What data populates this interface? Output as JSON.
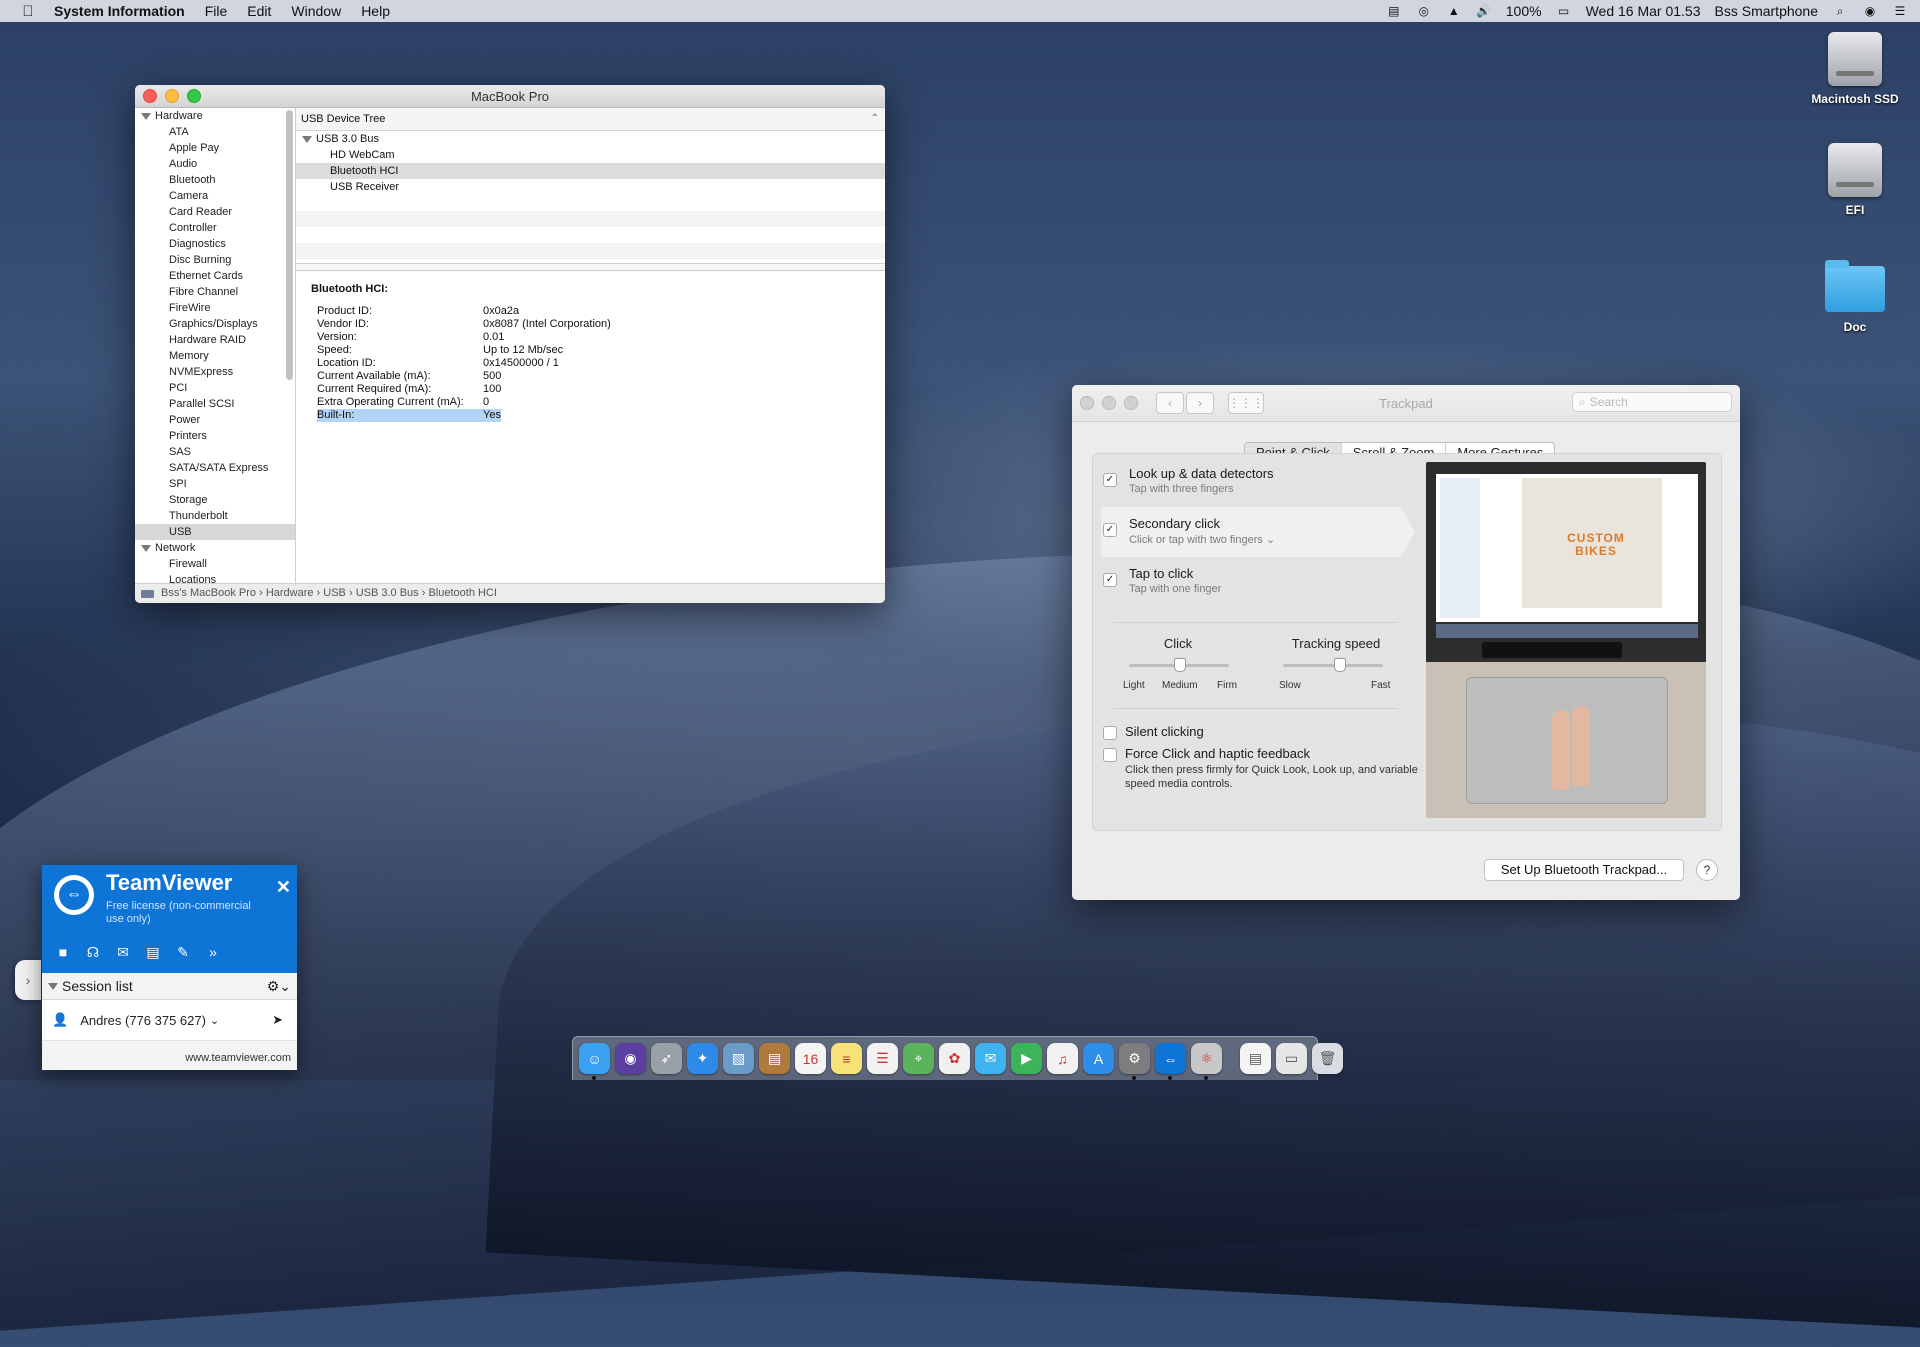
{
  "menubar": {
    "app": "System Information",
    "menus": [
      "File",
      "Edit",
      "Window",
      "Help"
    ],
    "battery": "100%",
    "datetime": "Wed 16 Mar  01.53",
    "user": "Bss Smartphone"
  },
  "desktop": {
    "icons": [
      {
        "label": "Macintosh SSD",
        "kind": "drive"
      },
      {
        "label": "EFI",
        "kind": "drive"
      },
      {
        "label": "Doc",
        "kind": "folder"
      }
    ]
  },
  "sysinfo": {
    "title": "MacBook Pro",
    "sidebar": {
      "hardware_label": "Hardware",
      "hardware_items": [
        "ATA",
        "Apple Pay",
        "Audio",
        "Bluetooth",
        "Camera",
        "Card Reader",
        "Controller",
        "Diagnostics",
        "Disc Burning",
        "Ethernet Cards",
        "Fibre Channel",
        "FireWire",
        "Graphics/Displays",
        "Hardware RAID",
        "Memory",
        "NVMExpress",
        "PCI",
        "Parallel SCSI",
        "Power",
        "Printers",
        "SAS",
        "SATA/SATA Express",
        "SPI",
        "Storage",
        "Thunderbolt",
        "USB"
      ],
      "selected": "USB",
      "network_label": "Network",
      "network_items": [
        "Firewall",
        "Locations"
      ]
    },
    "header": "USB Device Tree",
    "tree": {
      "root": "USB 3.0 Bus",
      "children": [
        "HD WebCam",
        "Bluetooth HCI",
        "USB Receiver"
      ],
      "selected": "Bluetooth HCI"
    },
    "detail": {
      "title": "Bluetooth HCI:",
      "rows": [
        {
          "k": "Product ID:",
          "v": "0x0a2a"
        },
        {
          "k": "Vendor ID:",
          "v": "0x8087  (Intel Corporation)"
        },
        {
          "k": "Version:",
          "v": "0.01"
        },
        {
          "k": "Speed:",
          "v": "Up to 12 Mb/sec"
        },
        {
          "k": "Location ID:",
          "v": "0x14500000 / 1"
        },
        {
          "k": "Current Available (mA):",
          "v": "500"
        },
        {
          "k": "Current Required (mA):",
          "v": "100"
        },
        {
          "k": "Extra Operating Current (mA):",
          "v": "0"
        },
        {
          "k": "Built-In:",
          "v": "Yes"
        }
      ],
      "highlighted": "Built-In:"
    },
    "path": [
      "Bss's MacBook Pro",
      "Hardware",
      "USB",
      "USB 3.0 Bus",
      "Bluetooth HCI"
    ]
  },
  "trackpad": {
    "title": "Trackpad",
    "search_placeholder": "Search",
    "tabs": [
      "Point & Click",
      "Scroll & Zoom",
      "More Gestures"
    ],
    "active_tab": "Point & Click",
    "options": [
      {
        "label": "Look up & data detectors",
        "sub": "Tap with three fingers",
        "checked": true
      },
      {
        "label": "Secondary click",
        "sub": "Click or tap with two fingers",
        "checked": true
      },
      {
        "label": "Tap to click",
        "sub": "Tap with one finger",
        "checked": true
      }
    ],
    "click": {
      "label": "Click",
      "ticks": [
        "Light",
        "Medium",
        "Firm"
      ],
      "value": "Medium"
    },
    "speed": {
      "label": "Tracking speed",
      "ticks": [
        "Slow",
        "Fast"
      ]
    },
    "silent_clicking": {
      "label": "Silent clicking",
      "checked": false
    },
    "force_click": {
      "label": "Force Click and haptic feedback",
      "sub": "Click then press firmly for Quick Look, Look up, and variable speed media controls.",
      "checked": false
    },
    "preview_text": "CUSTOM BIKES",
    "setup_button": "Set Up Bluetooth Trackpad...",
    "help": "?"
  },
  "teamviewer": {
    "name": "TeamViewer",
    "license": "Free license (non-commercial use only)",
    "session_list": "Session list",
    "contact": "Andres (776 375 627)",
    "url": "www.teamviewer.com"
  },
  "dock": {
    "apps": [
      {
        "name": "finder",
        "color": "#3aa0f0",
        "glyph": "☺",
        "running": true
      },
      {
        "name": "siri",
        "color": "#5a3fa0",
        "glyph": "◉",
        "running": false
      },
      {
        "name": "launchpad",
        "color": "#9aa0a8",
        "glyph": "➶",
        "running": false
      },
      {
        "name": "safari",
        "color": "#2d8ae8",
        "glyph": "✦",
        "running": false
      },
      {
        "name": "preview",
        "color": "#6b9bc8",
        "glyph": "▧",
        "running": false
      },
      {
        "name": "contacts",
        "color": "#b07a3a",
        "glyph": "▤",
        "running": false
      },
      {
        "name": "calendar",
        "color": "#f4f4f4",
        "glyph": "16",
        "running": false
      },
      {
        "name": "notes",
        "color": "#f7e27a",
        "glyph": "≡",
        "running": false
      },
      {
        "name": "reminders",
        "color": "#f2f2f2",
        "glyph": "☰",
        "running": false
      },
      {
        "name": "maps",
        "color": "#5bb35b",
        "glyph": "⌖",
        "running": false
      },
      {
        "name": "photos",
        "color": "#f0f0f0",
        "glyph": "✿",
        "running": false
      },
      {
        "name": "messages",
        "color": "#3fb3f0",
        "glyph": "✉",
        "running": false
      },
      {
        "name": "facetime",
        "color": "#3cb45a",
        "glyph": "▶",
        "running": false
      },
      {
        "name": "music",
        "color": "#f2f2f2",
        "glyph": "♫",
        "running": false
      },
      {
        "name": "app-store",
        "color": "#2d8de8",
        "glyph": "A",
        "running": false
      },
      {
        "name": "system-preferences",
        "color": "#7d7d7d",
        "glyph": "⚙",
        "running": true
      },
      {
        "name": "teamviewer",
        "color": "#0e75d6",
        "glyph": "⇔",
        "running": true
      },
      {
        "name": "system-information",
        "color": "#c8c8c8",
        "glyph": "⚛",
        "running": true
      }
    ],
    "docs": [
      {
        "name": "document",
        "color": "#f4f4f4",
        "glyph": "▤"
      },
      {
        "name": "downloads",
        "color": "#e6e6e6",
        "glyph": "▭"
      },
      {
        "name": "trash",
        "color": "#d8dde3",
        "glyph": "🗑"
      }
    ]
  }
}
